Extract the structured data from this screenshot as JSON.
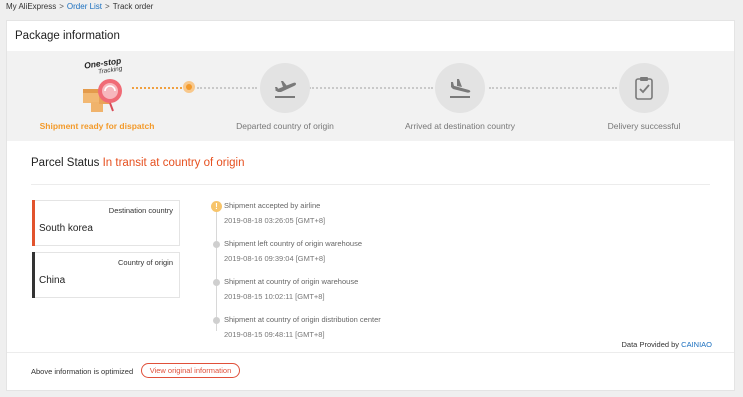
{
  "breadcrumb": {
    "home": "My AliExpress",
    "separator": ">",
    "order_list": "Order List",
    "current": "Track order"
  },
  "panel": {
    "title": "Package information"
  },
  "progress": {
    "brand_line1": "One-stop",
    "brand_line2": "Tracking",
    "steps": [
      {
        "label": "Shipment ready for dispatch",
        "icon": "one-stop-tracking-box-icon",
        "active": true
      },
      {
        "label": "Departed country of origin",
        "icon": "plane-takeoff-icon",
        "active": false
      },
      {
        "label": "Arrived at destination country",
        "icon": "plane-landing-icon",
        "active": false
      },
      {
        "label": "Delivery successful",
        "icon": "clipboard-check-icon",
        "active": false
      }
    ],
    "active_color": "#f39a2a"
  },
  "status": {
    "label": "Parcel Status",
    "value": "In transit at country of origin",
    "value_color": "#e6501f"
  },
  "locations": [
    {
      "caption": "Destination country",
      "name": "South korea",
      "bar_color": "#e2532d"
    },
    {
      "caption": "Country of origin",
      "name": "China",
      "bar_color": "#333333"
    }
  ],
  "timeline": [
    {
      "event": "Shipment accepted by airline",
      "time": "2019-08-18 03:26:05 [GMT+8]",
      "current": true,
      "marker": "!"
    },
    {
      "event": "Shipment left country of origin warehouse",
      "time": "2019-08-16 09:39:04 [GMT+8]",
      "current": false
    },
    {
      "event": "Shipment at country of origin warehouse",
      "time": "2019-08-15 10:02:11 [GMT+8]",
      "current": false
    },
    {
      "event": "Shipment at country of origin distribution center",
      "time": "2019-08-15 09:48:11 [GMT+8]",
      "current": false
    }
  ],
  "provider": {
    "prefix": "Data Provided by",
    "name": "CAINIAO"
  },
  "footer": {
    "optimized_text": "Above information is optimized",
    "view_original_label": "View original information"
  }
}
